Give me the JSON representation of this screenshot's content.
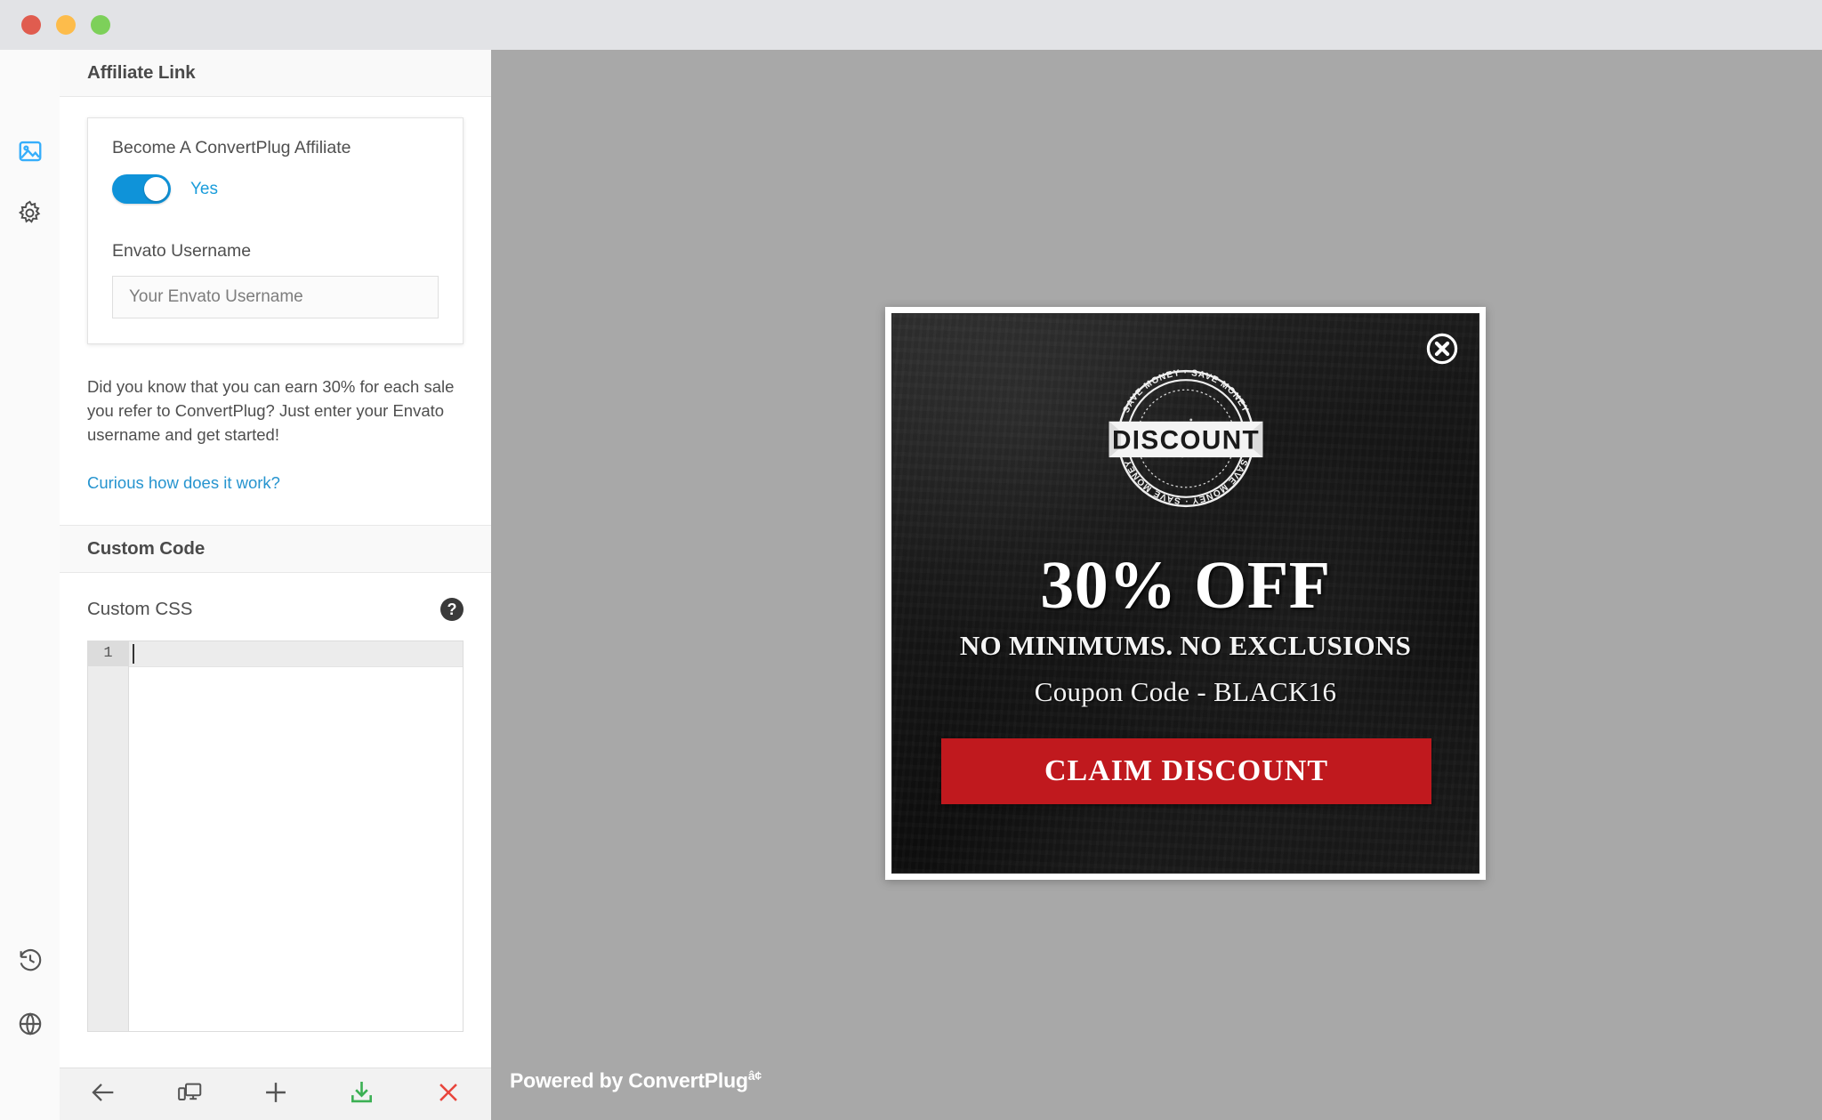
{
  "window": {
    "traffic_lights": [
      {
        "name": "close",
        "color": "#e05c4f"
      },
      {
        "name": "minimize",
        "color": "#fdbc4b"
      },
      {
        "name": "maximize",
        "color": "#7dd05a"
      }
    ]
  },
  "rail": {
    "items": [
      {
        "icon": "image-icon",
        "active": true
      },
      {
        "icon": "gear-icon",
        "active": false
      }
    ],
    "bottom_items": [
      {
        "icon": "history-icon"
      },
      {
        "icon": "globe-icon"
      }
    ]
  },
  "panel": {
    "sections": [
      {
        "title": "Affiliate Link"
      },
      {
        "title": "Custom Code"
      }
    ],
    "affiliate": {
      "toggle_label": "Become A ConvertPlug Affiliate",
      "toggle_value": "Yes",
      "toggle_on": true,
      "username_label": "Envato Username",
      "username_value": "",
      "username_placeholder": "Your Envato Username",
      "info_text": "Did you know that you can earn 30% for each sale you refer to ConvertPlug? Just enter your Envato username and get started!",
      "info_link": "Curious how does it work?"
    },
    "custom_code": {
      "css_label": "Custom CSS",
      "help_icon": "question-mark-icon",
      "help_glyph": "?",
      "editor_line_number": "1",
      "editor_content": ""
    },
    "accent_color": "#1b9ddb",
    "toggle_color": "#0f93d9"
  },
  "bottom_toolbar": {
    "buttons": [
      {
        "name": "back-button",
        "icon": "arrow-left-icon",
        "color": "#555555"
      },
      {
        "name": "responsive-preview-button",
        "icon": "devices-icon",
        "color": "#555555"
      },
      {
        "name": "add-button",
        "icon": "plus-icon",
        "color": "#555555"
      },
      {
        "name": "save-button",
        "icon": "download-icon",
        "color": "#3cb054"
      },
      {
        "name": "close-button",
        "icon": "x-icon",
        "color": "#e8453c"
      }
    ]
  },
  "canvas": {
    "background_color": "#a8a8a8",
    "powered_by": "Powered by ConvertPlug",
    "powered_by_suffix": "â¢"
  },
  "modal": {
    "close_icon": "close-circle-icon",
    "stamp": {
      "ribbon_text": "DISCOUNT",
      "arc_top_text": "SAVE MONEY · SAVE MONEY",
      "arc_bottom_text": "SAVE MONEY · SAVE MONEY"
    },
    "headline": "30% OFF",
    "subline_1": "NO MINIMUMS. NO EXCLUSIONS",
    "subline_2": "Coupon Code - BLACK16",
    "cta_label": "CLAIM DISCOUNT",
    "cta_color": "#c0191e",
    "background_color": "#141414",
    "border_color": "#ffffff"
  }
}
